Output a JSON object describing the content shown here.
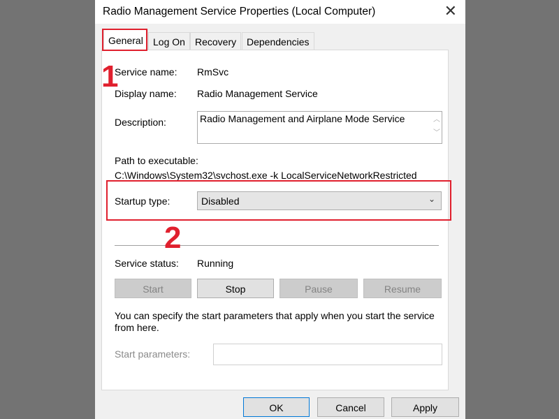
{
  "window": {
    "title": "Radio Management Service Properties (Local Computer)"
  },
  "tabs": [
    {
      "label": "General"
    },
    {
      "label": "Log On"
    },
    {
      "label": "Recovery"
    },
    {
      "label": "Dependencies"
    }
  ],
  "general": {
    "service_name_label": "Service name:",
    "service_name": "RmSvc",
    "display_name_label": "Display name:",
    "display_name": "Radio Management Service",
    "description_label": "Description:",
    "description": "Radio Management and Airplane Mode Service",
    "path_label": "Path to executable:",
    "path": "C:\\Windows\\System32\\svchost.exe -k LocalServiceNetworkRestricted",
    "startup_type_label": "Startup type:",
    "startup_type": "Disabled",
    "status_label": "Service status:",
    "status": "Running",
    "buttons": {
      "start": "Start",
      "stop": "Stop",
      "pause": "Pause",
      "resume": "Resume"
    },
    "hint": "You can specify the start parameters that apply when you start the service from here.",
    "start_params_label": "Start parameters:",
    "start_params_value": ""
  },
  "footer": {
    "ok": "OK",
    "cancel": "Cancel",
    "apply": "Apply"
  },
  "annotations": {
    "step1": "1",
    "step2": "2",
    "color": "#e0202e"
  }
}
